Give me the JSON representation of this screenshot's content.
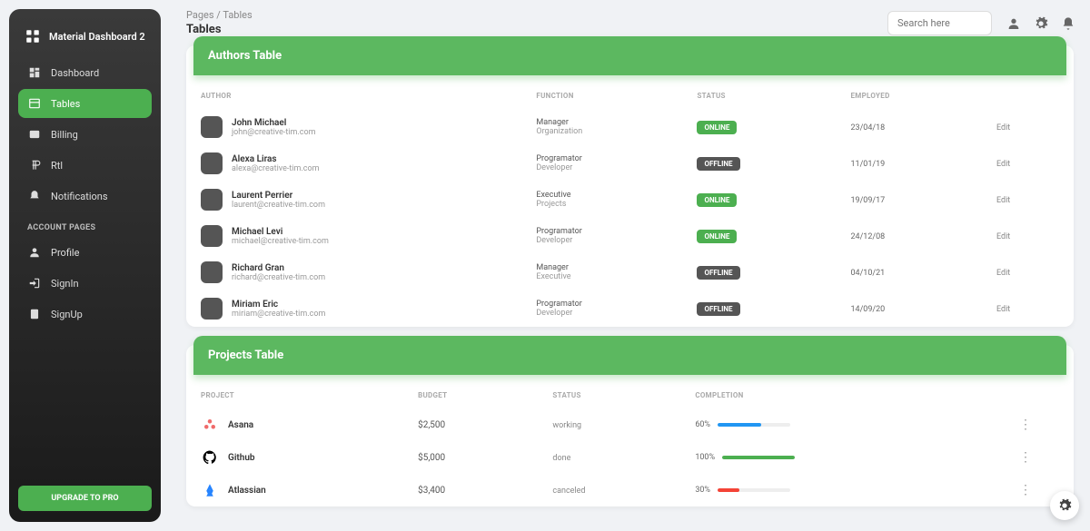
{
  "brand": "Material Dashboard 2",
  "nav": [
    {
      "label": "Dashboard",
      "icon": "dashboard-icon"
    },
    {
      "label": "Tables",
      "icon": "table-icon",
      "active": true
    },
    {
      "label": "Billing",
      "icon": "billing-icon"
    },
    {
      "label": "Rtl",
      "icon": "rtl-icon"
    },
    {
      "label": "Notifications",
      "icon": "bell-icon"
    }
  ],
  "account_section": "ACCOUNT PAGES",
  "account_nav": [
    {
      "label": "Profile",
      "icon": "person-icon"
    },
    {
      "label": "SignIn",
      "icon": "signin-icon"
    },
    {
      "label": "SignUp",
      "icon": "signup-icon"
    }
  ],
  "upgrade": "UPGRADE TO PRO",
  "breadcrumb": {
    "root": "Pages",
    "sep": "/",
    "current": "Tables"
  },
  "page_title": "Tables",
  "search_placeholder": "Search here",
  "authors_table": {
    "title": "Authors Table",
    "columns": [
      "AUTHOR",
      "FUNCTION",
      "STATUS",
      "EMPLOYED",
      ""
    ],
    "rows": [
      {
        "name": "John Michael",
        "email": "john@creative-tim.com",
        "func": "Manager",
        "sub": "Organization",
        "status": "ONLINE",
        "date": "23/04/18"
      },
      {
        "name": "Alexa Liras",
        "email": "alexa@creative-tim.com",
        "func": "Programator",
        "sub": "Developer",
        "status": "OFFLINE",
        "date": "11/01/19"
      },
      {
        "name": "Laurent Perrier",
        "email": "laurent@creative-tim.com",
        "func": "Executive",
        "sub": "Projects",
        "status": "ONLINE",
        "date": "19/09/17"
      },
      {
        "name": "Michael Levi",
        "email": "michael@creative-tim.com",
        "func": "Programator",
        "sub": "Developer",
        "status": "ONLINE",
        "date": "24/12/08"
      },
      {
        "name": "Richard Gran",
        "email": "richard@creative-tim.com",
        "func": "Manager",
        "sub": "Executive",
        "status": "OFFLINE",
        "date": "04/10/21"
      },
      {
        "name": "Miriam Eric",
        "email": "miriam@creative-tim.com",
        "func": "Programator",
        "sub": "Developer",
        "status": "OFFLINE",
        "date": "14/09/20"
      }
    ],
    "edit_label": "Edit"
  },
  "projects_table": {
    "title": "Projects Table",
    "columns": [
      "PROJECT",
      "BUDGET",
      "STATUS",
      "COMPLETION",
      ""
    ],
    "rows": [
      {
        "name": "Asana",
        "budget": "$2,500",
        "status": "working",
        "pct": 60,
        "color": "#2196f3",
        "icon": "asana-icon"
      },
      {
        "name": "Github",
        "budget": "$5,000",
        "status": "done",
        "pct": 100,
        "color": "#4caf50",
        "icon": "github-icon"
      },
      {
        "name": "Atlassian",
        "budget": "$3,400",
        "status": "canceled",
        "pct": 30,
        "color": "#f44336",
        "icon": "atlassian-icon"
      }
    ]
  },
  "colors": {
    "accent": "#4caf50",
    "header": "#5cb860"
  }
}
